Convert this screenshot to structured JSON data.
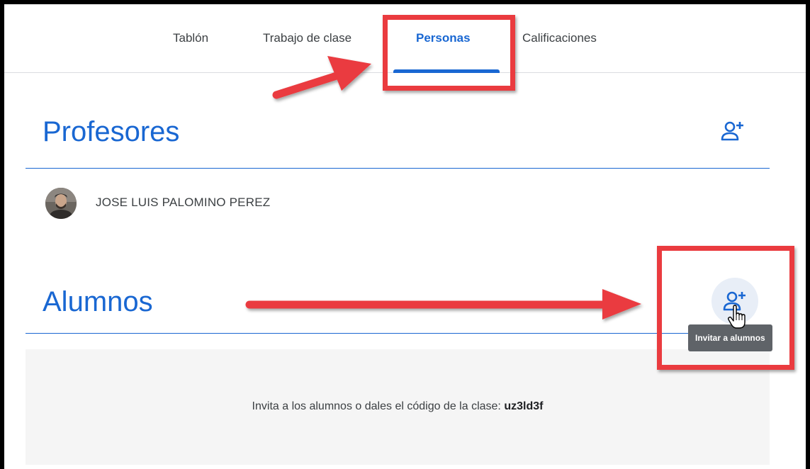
{
  "tabs": [
    {
      "label": "Tablón",
      "active": false
    },
    {
      "label": "Trabajo de clase",
      "active": false
    },
    {
      "label": "Personas",
      "active": true
    },
    {
      "label": "Calificaciones",
      "active": false
    }
  ],
  "teachers": {
    "title": "Profesores",
    "add_icon": "person-add-icon",
    "members": [
      {
        "name": "JOSE LUIS PALOMINO PEREZ",
        "avatar": "avatar-photo"
      }
    ]
  },
  "students": {
    "title": "Alumnos",
    "add_icon": "person-add-icon",
    "tooltip": "Invitar a alumnos",
    "invite_text": "Invita a los alumnos o dales el código de la clase:",
    "class_code": "uz3ld3f"
  },
  "colors": {
    "accent": "#1967d2",
    "annotation": "#ea3b3f",
    "tooltip_bg": "#5f6368",
    "invite_bg": "#f5f5f5"
  }
}
